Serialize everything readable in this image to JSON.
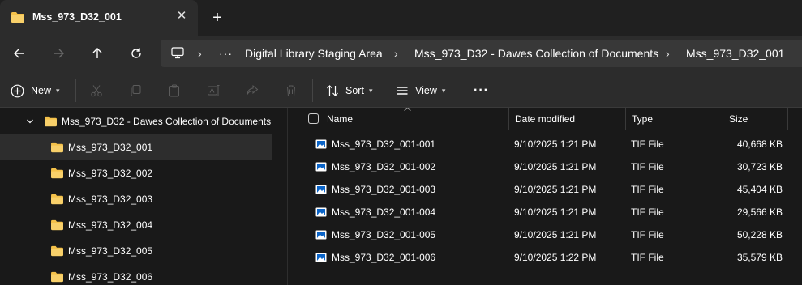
{
  "tab": {
    "title": "Mss_973_D32_001",
    "close_label": "✕",
    "new_tab_label": "+"
  },
  "nav": {
    "back_label": "Back",
    "forward_label": "Forward",
    "up_label": "Up",
    "refresh_label": "Refresh"
  },
  "address": {
    "overflow": "···",
    "crumbs": [
      "Digital Library Staging Area",
      "Mss_973_D32 - Dawes Collection of Documents",
      "Mss_973_D32_001"
    ]
  },
  "toolbar": {
    "new_label": "New",
    "sort_label": "Sort",
    "view_label": "View",
    "more_label": "···"
  },
  "sidebar": {
    "parent": "Mss_973_D32 - Dawes Collection of Documents",
    "items": [
      "Mss_973_D32_001",
      "Mss_973_D32_002",
      "Mss_973_D32_003",
      "Mss_973_D32_004",
      "Mss_973_D32_005",
      "Mss_973_D32_006"
    ]
  },
  "columns": {
    "name": "Name",
    "date": "Date modified",
    "type": "Type",
    "size": "Size"
  },
  "files": [
    {
      "name": "Mss_973_D32_001-001",
      "date": "9/10/2025 1:21 PM",
      "type": "TIF File",
      "size": "40,668 KB"
    },
    {
      "name": "Mss_973_D32_001-002",
      "date": "9/10/2025 1:21 PM",
      "type": "TIF File",
      "size": "30,723 KB"
    },
    {
      "name": "Mss_973_D32_001-003",
      "date": "9/10/2025 1:21 PM",
      "type": "TIF File",
      "size": "45,404 KB"
    },
    {
      "name": "Mss_973_D32_001-004",
      "date": "9/10/2025 1:21 PM",
      "type": "TIF File",
      "size": "29,566 KB"
    },
    {
      "name": "Mss_973_D32_001-005",
      "date": "9/10/2025 1:21 PM",
      "type": "TIF File",
      "size": "50,228 KB"
    },
    {
      "name": "Mss_973_D32_001-006",
      "date": "9/10/2025 1:22 PM",
      "type": "TIF File",
      "size": "35,579 KB"
    }
  ],
  "colors": {
    "folder": "#f4c14a",
    "accent": "#0a64c8",
    "background": "#191919",
    "chrome": "#2c2c2c"
  }
}
